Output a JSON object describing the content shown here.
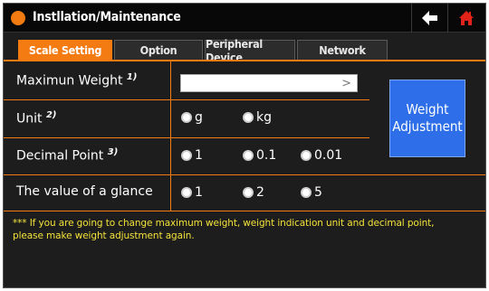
{
  "window": {
    "title": "Instllation/Maintenance",
    "accent": "#f47a12"
  },
  "titlebar": {
    "back_icon": "arrow-left-icon",
    "home_icon": "home-icon"
  },
  "tabs": [
    {
      "label": "Scale Setting",
      "active": true
    },
    {
      "label": "Option",
      "active": false
    },
    {
      "label": "Peripheral Device",
      "active": false
    },
    {
      "label": "Network",
      "active": false
    }
  ],
  "settings": {
    "max_weight": {
      "label": "Maximun Weight",
      "note": "1)",
      "value": ""
    },
    "unit": {
      "label": "Unit",
      "note": "2)",
      "options": [
        "g",
        "kg"
      ],
      "selected": "g"
    },
    "decimal_point": {
      "label": "Decimal Point",
      "note": "3)",
      "options": [
        "1",
        "0.1",
        "0.01"
      ],
      "selected": "1"
    },
    "glance": {
      "label": "The value of a glance",
      "options": [
        "1",
        "2",
        "5"
      ],
      "selected": "1"
    }
  },
  "adjust_button": {
    "line1": "Weight",
    "line2": "Adjustment",
    "color": "#2e6ee8"
  },
  "note": {
    "line1": "*** If you are going to change maximum weight, weight indication unit and decimal point,",
    "line2": "please make weight adjustment again."
  }
}
